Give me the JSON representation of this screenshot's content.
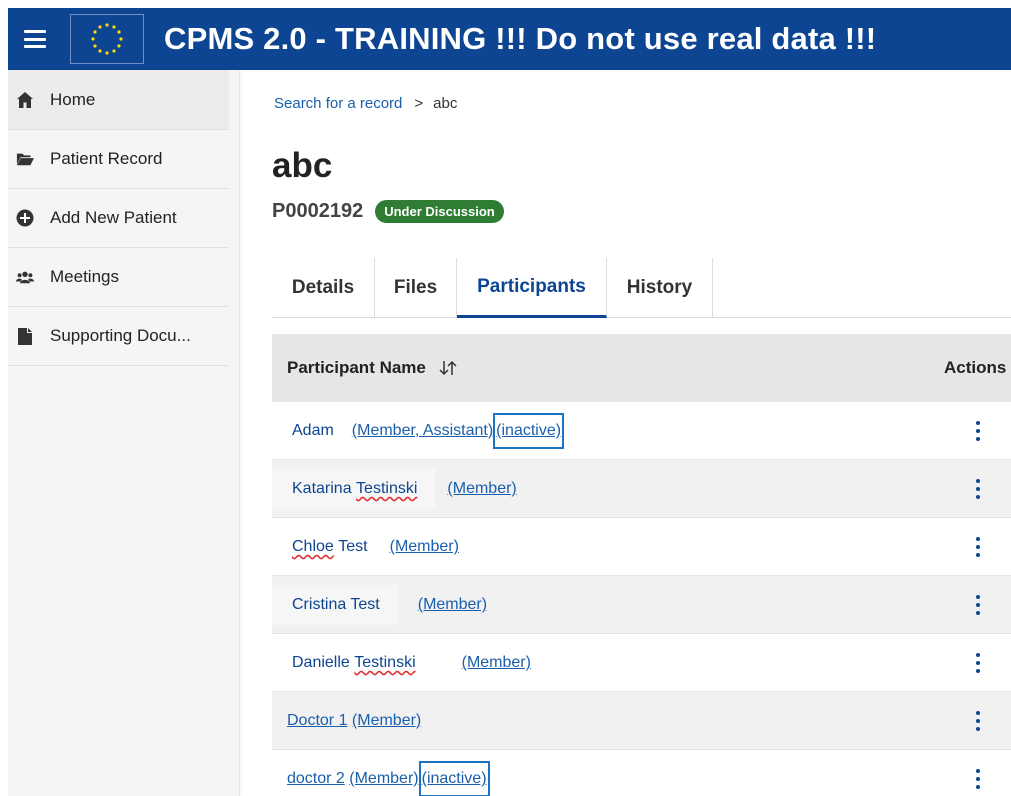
{
  "header": {
    "title": "CPMS 2.0 - TRAINING !!! Do not use real data !!!",
    "colors": {
      "bar": "#0d4592",
      "accent": "#ffdd00"
    }
  },
  "sidebar": {
    "items": [
      {
        "label": "Home",
        "icon": "home-icon"
      },
      {
        "label": "Patient Record",
        "icon": "folder-open-icon"
      },
      {
        "label": "Add New Patient",
        "icon": "plus-circle-icon"
      },
      {
        "label": "Meetings",
        "icon": "users-icon"
      },
      {
        "label": "Supporting Docu...",
        "icon": "document-icon"
      }
    ]
  },
  "breadcrumb": {
    "link": "Search for a record",
    "separator": ">",
    "current": "abc"
  },
  "record": {
    "title": "abc",
    "id": "P0002192",
    "status": "Under Discussion",
    "status_color": "#2e7d32"
  },
  "tabs": [
    {
      "label": "Details"
    },
    {
      "label": "Files"
    },
    {
      "label": "Participants",
      "active": true
    },
    {
      "label": "History"
    }
  ],
  "table": {
    "headers": {
      "name": "Participant Name",
      "actions": "Actions"
    },
    "rows": [
      {
        "name": "Adam",
        "role": "(Member, Assistant)",
        "flag": "(inactive)"
      },
      {
        "name_first": "Katarina",
        "name_last": "Testinski",
        "role": "(Member)"
      },
      {
        "name_first": "Chloe",
        "name_last": "Test",
        "role": "(Member)"
      },
      {
        "name": "Cristina Test",
        "role": "(Member)"
      },
      {
        "name_first": "Danielle",
        "name_last": "Testinski",
        "role": "(Member)"
      },
      {
        "name": "Doctor 1",
        "role": "(Member)"
      },
      {
        "name": "doctor 2",
        "role": "(Member)",
        "flag": "(inactive)"
      }
    ]
  }
}
